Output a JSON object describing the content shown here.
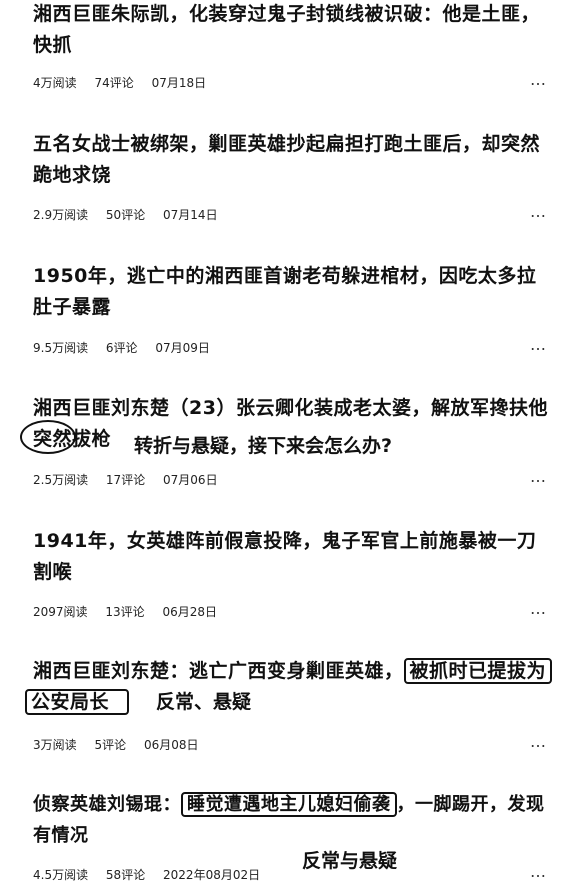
{
  "articles": [
    {
      "title": "湘西巨匪朱际凯，化装穿过鬼子封锁线被识破：他是土匪，快抓",
      "reads": "4万阅读",
      "comments": "74评论",
      "date": "07月18日"
    },
    {
      "title": "五名女战士被绑架，剿匪英雄抄起扁担打跑土匪后，却突然跪地求饶",
      "reads": "2.9万阅读",
      "comments": "50评论",
      "date": "07月14日"
    },
    {
      "title": "1950年，逃亡中的湘西匪首谢老苟躲进棺材，因吃太多拉肚子暴露",
      "reads": "9.5万阅读",
      "comments": "6评论",
      "date": "07月09日"
    },
    {
      "title_line1": "湘西巨匪刘东楚（23）张云卿化装成老太婆，解放军搀扶他",
      "title_line2_circled": "突然",
      "title_line2_rest": "拔枪",
      "reads": "2.5万阅读",
      "comments": "17评论",
      "date": "07月06日"
    },
    {
      "title": "1941年，女英雄阵前假意投降，鬼子军官上前施暴被一刀割喉",
      "reads": "2097阅读",
      "comments": "13评论",
      "date": "06月28日"
    },
    {
      "title_prefix": "湘西巨匪刘东楚：逃亡广西变身剿匪英雄，",
      "title_boxed1": "被抓时已提拔为",
      "title_boxed2": "公安局长",
      "reads": "3万阅读",
      "comments": "5评论",
      "date": "06月08日"
    },
    {
      "title_prefix": "侦察英雄刘锡琨：",
      "title_boxed": "睡觉遭遇地主儿媳妇偷袭",
      "title_suffix": "，一脚踢开，发现有情况",
      "reads": "4.5万阅读",
      "comments": "58评论",
      "date": "2022年08月02日"
    }
  ],
  "more_icon": "…",
  "annotations": {
    "a1": "转折与悬疑，接下来会怎么办?",
    "a2": "反常、悬疑",
    "a3": "反常与悬疑"
  }
}
